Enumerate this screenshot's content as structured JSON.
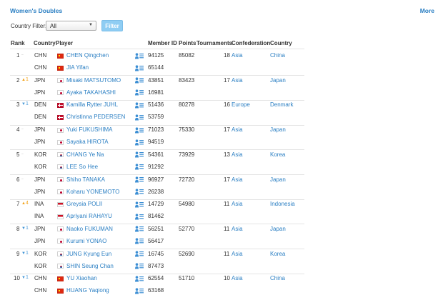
{
  "section_title": "Women's Doubles",
  "more_label": "More",
  "filter": {
    "label": "Country Filter:",
    "selected": "All",
    "button_label": "Filter"
  },
  "columns": {
    "rank": "Rank",
    "country": "Country",
    "player": "Player",
    "member_id": "Member ID",
    "points": "Points",
    "tournaments": "Tournaments",
    "confederation": "Confederation",
    "country_name": "Country"
  },
  "rows": [
    {
      "rank": "1",
      "trend": "same",
      "trend_value": "",
      "points": "85082",
      "tournaments": "18",
      "confederation": "Asia",
      "country_name": "China",
      "players": [
        {
          "country": "CHN",
          "flag": "chn",
          "name": "CHEN Qingchen",
          "member_id": "94125"
        },
        {
          "country": "CHN",
          "flag": "chn",
          "name": "JIA Yifan",
          "member_id": "65144"
        }
      ]
    },
    {
      "rank": "2",
      "trend": "up",
      "trend_value": "1",
      "points": "83423",
      "tournaments": "17",
      "confederation": "Asia",
      "country_name": "Japan",
      "players": [
        {
          "country": "JPN",
          "flag": "jpn",
          "name": "Misaki MATSUTOMO",
          "member_id": "43851"
        },
        {
          "country": "JPN",
          "flag": "jpn",
          "name": "Ayaka TAKAHASHI",
          "member_id": "16981"
        }
      ]
    },
    {
      "rank": "3",
      "trend": "down",
      "trend_value": "1",
      "points": "80278",
      "tournaments": "16",
      "confederation": "Europe",
      "country_name": "Denmark",
      "players": [
        {
          "country": "DEN",
          "flag": "den",
          "name": "Kamilla Rytter JUHL",
          "member_id": "51436"
        },
        {
          "country": "DEN",
          "flag": "den",
          "name": "Christinna PEDERSEN",
          "member_id": "53759"
        }
      ]
    },
    {
      "rank": "4",
      "trend": "same",
      "trend_value": "",
      "points": "75330",
      "tournaments": "17",
      "confederation": "Asia",
      "country_name": "Japan",
      "players": [
        {
          "country": "JPN",
          "flag": "jpn",
          "name": "Yuki FUKUSHIMA",
          "member_id": "71023"
        },
        {
          "country": "JPN",
          "flag": "jpn",
          "name": "Sayaka HIROTA",
          "member_id": "94519"
        }
      ]
    },
    {
      "rank": "5",
      "trend": "same",
      "trend_value": "",
      "points": "73929",
      "tournaments": "13",
      "confederation": "Asia",
      "country_name": "Korea",
      "players": [
        {
          "country": "KOR",
          "flag": "kor",
          "name": "CHANG Ye Na",
          "member_id": "54361"
        },
        {
          "country": "KOR",
          "flag": "kor",
          "name": "LEE So Hee",
          "member_id": "91292"
        }
      ]
    },
    {
      "rank": "6",
      "trend": "same",
      "trend_value": "",
      "points": "72720",
      "tournaments": "17",
      "confederation": "Asia",
      "country_name": "Japan",
      "players": [
        {
          "country": "JPN",
          "flag": "jpn",
          "name": "Shiho TANAKA",
          "member_id": "96927"
        },
        {
          "country": "JPN",
          "flag": "jpn",
          "name": "Koharu YONEMOTO",
          "member_id": "26238"
        }
      ]
    },
    {
      "rank": "7",
      "trend": "up",
      "trend_value": "4",
      "points": "54980",
      "tournaments": "11",
      "confederation": "Asia",
      "country_name": "Indonesia",
      "players": [
        {
          "country": "INA",
          "flag": "ina",
          "name": "Greysia POLII",
          "member_id": "14729"
        },
        {
          "country": "INA",
          "flag": "ina",
          "name": "Apriyani RAHAYU",
          "member_id": "81462"
        }
      ]
    },
    {
      "rank": "8",
      "trend": "down",
      "trend_value": "1",
      "points": "52770",
      "tournaments": "11",
      "confederation": "Asia",
      "country_name": "Japan",
      "players": [
        {
          "country": "JPN",
          "flag": "jpn",
          "name": "Naoko FUKUMAN",
          "member_id": "56251"
        },
        {
          "country": "JPN",
          "flag": "jpn",
          "name": "Kurumi YONAO",
          "member_id": "56417"
        }
      ]
    },
    {
      "rank": "9",
      "trend": "down",
      "trend_value": "1",
      "points": "52690",
      "tournaments": "11",
      "confederation": "Asia",
      "country_name": "Korea",
      "players": [
        {
          "country": "KOR",
          "flag": "kor",
          "name": "JUNG Kyung Eun",
          "member_id": "16745"
        },
        {
          "country": "KOR",
          "flag": "kor",
          "name": "SHIN Seung Chan",
          "member_id": "87473"
        }
      ]
    },
    {
      "rank": "10",
      "trend": "down",
      "trend_value": "1",
      "points": "51710",
      "tournaments": "10",
      "confederation": "Asia",
      "country_name": "China",
      "players": [
        {
          "country": "CHN",
          "flag": "chn",
          "name": "YU Xiaohan",
          "member_id": "62554"
        },
        {
          "country": "CHN",
          "flag": "chn",
          "name": "HUANG Yaqiong",
          "member_id": "63168"
        }
      ]
    }
  ],
  "colors": {
    "link": "#2b7fc3",
    "trend_up": "#f2a31b",
    "trend_down": "#4a9ad8",
    "filter_button": "#8fcdf3"
  }
}
